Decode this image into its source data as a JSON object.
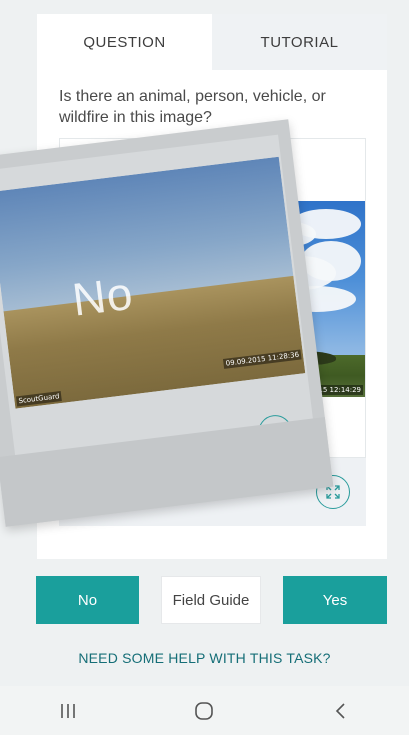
{
  "tabs": [
    {
      "label": "QUESTION",
      "active": true
    },
    {
      "label": "TUTORIAL",
      "active": false
    }
  ],
  "question": "Is there an animal, person, vehicle, or wildfire in this image?",
  "back_card": {
    "timestamp": "12.26.2015 12:14:29",
    "expand_icon": "expand-arrows-icon"
  },
  "front_card": {
    "overlay_label": "No",
    "timestamp": "09.09.2015 11:28:36",
    "watermark": "ScoutGuard",
    "expand_icon": "expand-arrows-icon"
  },
  "actions": {
    "no_label": "No",
    "field_guide_label": "Field Guide",
    "yes_label": "Yes"
  },
  "help_link": "NEED SOME HELP WITH THIS TASK?",
  "nav": {
    "recents_icon": "recents-icon",
    "home_icon": "home-icon",
    "back_icon": "back-icon"
  },
  "colors": {
    "accent": "#1a9f9c",
    "link": "#156e77",
    "background": "#eef1f2"
  }
}
